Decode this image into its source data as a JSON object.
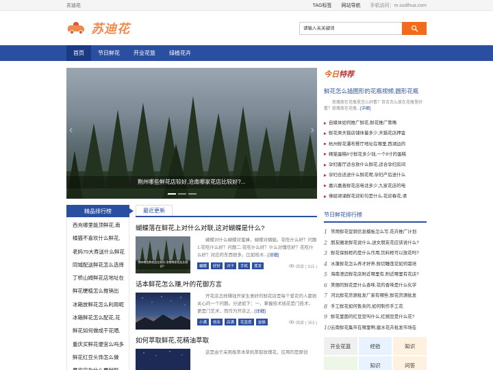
{
  "topbar": {
    "site_name": "苏迪花",
    "links": [
      "TAG标签",
      "网站导航"
    ],
    "mobile_label": "手机访问：m.sudihua.com"
  },
  "header": {
    "logo_text": "苏迪花",
    "search_placeholder": "请输入关关键词"
  },
  "nav": {
    "items": [
      "首页",
      "节日鲜花",
      "开业花篮",
      "绿植花卉"
    ]
  },
  "banner": {
    "caption": "荆州哪些鲜花店较好,沧南哪家花店比较好?..."
  },
  "rank": {
    "title": "精品排行榜",
    "items": [
      "西充哪里能顶鲜花,南",
      "橘猫不喜欢什么鲜花,",
      "老妈70大寿送什么鲜花",
      "同城配送鲜花怎么选择",
      "丁桥山姆鲜花店地址在",
      "鲜花梗植怎么推销出",
      "冰箱放鲜花怎么利用呢",
      "冰箱鲜花怎么配花,花",
      "鲜花如何做成干花晒,",
      "重庆买鲜花便宜么吗多",
      "鲜花红豆头饰怎么做",
      "鹰京宗为什么要献鲜"
    ]
  },
  "latest": {
    "tab_label": "最近更新",
    "articles": [
      {
        "title": "蝴蝶落在鲜花上对什么对联,这对蝴蝶是什么?",
        "summary": "蝴蝶对什么蝴蝶对蜜蜂，蝴蝶对蜻蜓。花吃什么好？问题1:花吃什么好？问题二:花吃什么好？什么对懂信好？花吃什么好？对应的东西很多，比如桔木...",
        "more": "[详细]",
        "thumb_caption": "荆州哪些鲜花店比较好,沧南哪家花店比较好？",
        "tags": [
          "蝴蝶",
          "好好",
          "对子",
          "手机",
          "蕉发"
        ],
        "views": "阅读 ( 915 )"
      },
      {
        "title": "话本鲜花怎么赚,叶的花御方言",
        "summary": "开花店怎样赚钱开家生意好的鲜花店是每个爱花的人都很关心的一个问题。分述如下：一、掌握技术插花是门技术，更是门艺术，而作为开店之...",
        "more": "[详细]",
        "thumb_caption": "",
        "tags": [
          "小满",
          "创业",
          "店满",
          "花显度",
          "金融"
        ],
        "views": "阅读 ( 353 )"
      },
      {
        "title": "如何萃取鲜花,花精油萃取",
        "summary": "这是由于采用极萃本草机萃取玫瑰花，应用的是原创",
        "more": "",
        "thumb_caption": "",
        "tags": [],
        "views": ""
      }
    ]
  },
  "today": {
    "logo_text": "今日",
    "logo_text2": "特荐",
    "feature_title": "鲜花怎么插图形的花瓶视频,圆形花瓶",
    "feature_desc": "玫瑰放在花瓶里怎么好看？百合怎么放在花瓶里好看？玫瑰放在花瓶...",
    "feature_more": "[详细]",
    "list": [
      "自媒体如何推广鲜花,鲜花推广策略",
      "鲜花类天猫店铺体量多少,天猫花店押金",
      "杭州鲜花瀑布餐厅地址在哪里,西湖边的",
      "精猫蛋糕8寸鲜花多少钱,一个8寸的蛋糕",
      "孕妇客厅适合放什么鲜花,适合孕妇房间",
      "孕妇合适送什么鲜花呢,孕妇产后送什么",
      "嘉兴嘉善鲜花店电话多少,九家花店的电",
      "佛经颂诵鲜花迎彩句是什么,花迎春花,请"
    ]
  },
  "festival": {
    "title": "节日鲜花排行榜",
    "items": [
      {
        "n": "1",
        "text": "常用鲜花促销信息模板怎么写,花卉推广计划"
      },
      {
        "n": "2",
        "text": "朋友圈发鲜花说什么,送女朋友花应该说什么?"
      },
      {
        "n": "3",
        "text": "鲜花保鲜柜的是什么作用,饮料柜可以放花吗?"
      },
      {
        "n": "4",
        "text": "水蓬鲜花怎么养才好养,鲜切睡莲花如何栽培"
      },
      {
        "n": "5",
        "text": "海南澄迈鲜花店附近哪里有,附近哪里有花店?"
      },
      {
        "n": "6",
        "text": "美丽的鲜花是什么香味,花的香味是什么化学"
      },
      {
        "n": "7",
        "text": "河北鲜花货源批发厂家有哪些,鲜花货源批发"
      },
      {
        "n": "8",
        "text": "手工鲜花如何售卖的,如何制作手工花"
      },
      {
        "n": "9",
        "text": "鲜花里面的红豆豆叫什么,红豌豆是什么花?"
      },
      {
        "n": "10",
        "text": "云南鲜花集市在哪里啊,建水花卉批发市场在"
      }
    ]
  },
  "grid": {
    "cells": [
      "开业花篮",
      "经验",
      "知识",
      "",
      "知识",
      "问答"
    ]
  }
}
